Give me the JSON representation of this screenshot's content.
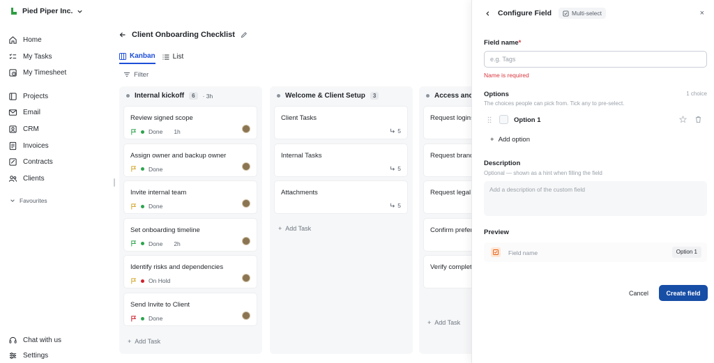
{
  "app": {
    "org_name": "Pied Piper Inc.",
    "brand_color": "#2f9e44"
  },
  "sidebar": {
    "items": [
      {
        "label": "Home",
        "icon": "home-icon"
      },
      {
        "label": "My Tasks",
        "icon": "tasks-icon"
      },
      {
        "label": "My Timesheet",
        "icon": "timesheet-icon"
      },
      {
        "label": "Projects",
        "icon": "projects-icon"
      },
      {
        "label": "Email",
        "icon": "email-icon"
      },
      {
        "label": "CRM",
        "icon": "crm-icon"
      },
      {
        "label": "Invoices",
        "icon": "invoices-icon"
      },
      {
        "label": "Contracts",
        "icon": "contracts-icon"
      },
      {
        "label": "Clients",
        "icon": "clients-icon"
      }
    ],
    "favourites_label": "Favourites",
    "footer": [
      {
        "label": "Chat with us",
        "icon": "headset-icon"
      },
      {
        "label": "Settings",
        "icon": "settings-icon"
      }
    ]
  },
  "project": {
    "title": "Client Onboarding Checklist",
    "tabs": [
      {
        "label": "Kanban",
        "active": true
      },
      {
        "label": "List",
        "active": false
      }
    ],
    "filter_label": "Filter",
    "add_task_label": "Add Task"
  },
  "columns": [
    {
      "name": "Internal kickoff",
      "count": "6",
      "estimate": "· 3h",
      "cards": [
        {
          "title": "Review signed scope",
          "flag_color": "#2da44e",
          "status": "Done",
          "status_color": "#2da44e",
          "time": "1h"
        },
        {
          "title": "Assign owner and backup owner",
          "flag_color": "#d4a72c",
          "status": "Done",
          "status_color": "#2da44e",
          "time": ""
        },
        {
          "title": "Invite internal team",
          "flag_color": "#d4a72c",
          "status": "Done",
          "status_color": "#2da44e",
          "time": ""
        },
        {
          "title": "Set onboarding timeline",
          "flag_color": "#2da44e",
          "status": "Done",
          "status_color": "#2da44e",
          "time": "2h"
        },
        {
          "title": "Identify risks and dependencies",
          "flag_color": "#d4a72c",
          "status": "On Hold",
          "status_color": "#cf222e",
          "time": ""
        },
        {
          "title": "Send Invite to Client",
          "flag_color": "#cf222e",
          "status": "Done",
          "status_color": "#2da44e",
          "time": ""
        }
      ]
    },
    {
      "name": "Welcome & Client Setup",
      "count": "3",
      "estimate": "",
      "cards": [
        {
          "title": "Client Tasks",
          "subtasks": "5"
        },
        {
          "title": "Internal Tasks",
          "subtasks": "5"
        },
        {
          "title": "Attachments",
          "subtasks": "5"
        }
      ]
    },
    {
      "name": "Access and a",
      "count": "",
      "estimate": "",
      "cards": [
        {
          "title": "Request logins"
        },
        {
          "title": "Request brand"
        },
        {
          "title": "Request legal d documents"
        },
        {
          "title": "Confirm prefer"
        },
        {
          "title": "Verify complete materials"
        }
      ]
    }
  ],
  "panel": {
    "title": "Configure Field",
    "type_badge": "Multi-select",
    "close_glyph": "×",
    "field_name_label": "Field name",
    "required_mark": "*",
    "field_name_placeholder": "e.g. Tags",
    "field_name_value": "",
    "error_text": "Name is required",
    "options_label": "Options",
    "options_count": "1 choice",
    "options_hint": "The choices people can pick from. Tick any to pre-select.",
    "options": [
      {
        "label": "Option 1"
      }
    ],
    "add_option_label": "Add option",
    "description_label": "Description",
    "description_hint": "Optional — shown as a hint when filling the field",
    "description_placeholder": "Add a description of the custom field",
    "preview_label": "Preview",
    "preview_field_label": "Field name",
    "preview_chip": "Option 1",
    "cancel_label": "Cancel",
    "create_label": "Create field",
    "primary_color": "#174ea6",
    "error_color": "#d9363e"
  }
}
